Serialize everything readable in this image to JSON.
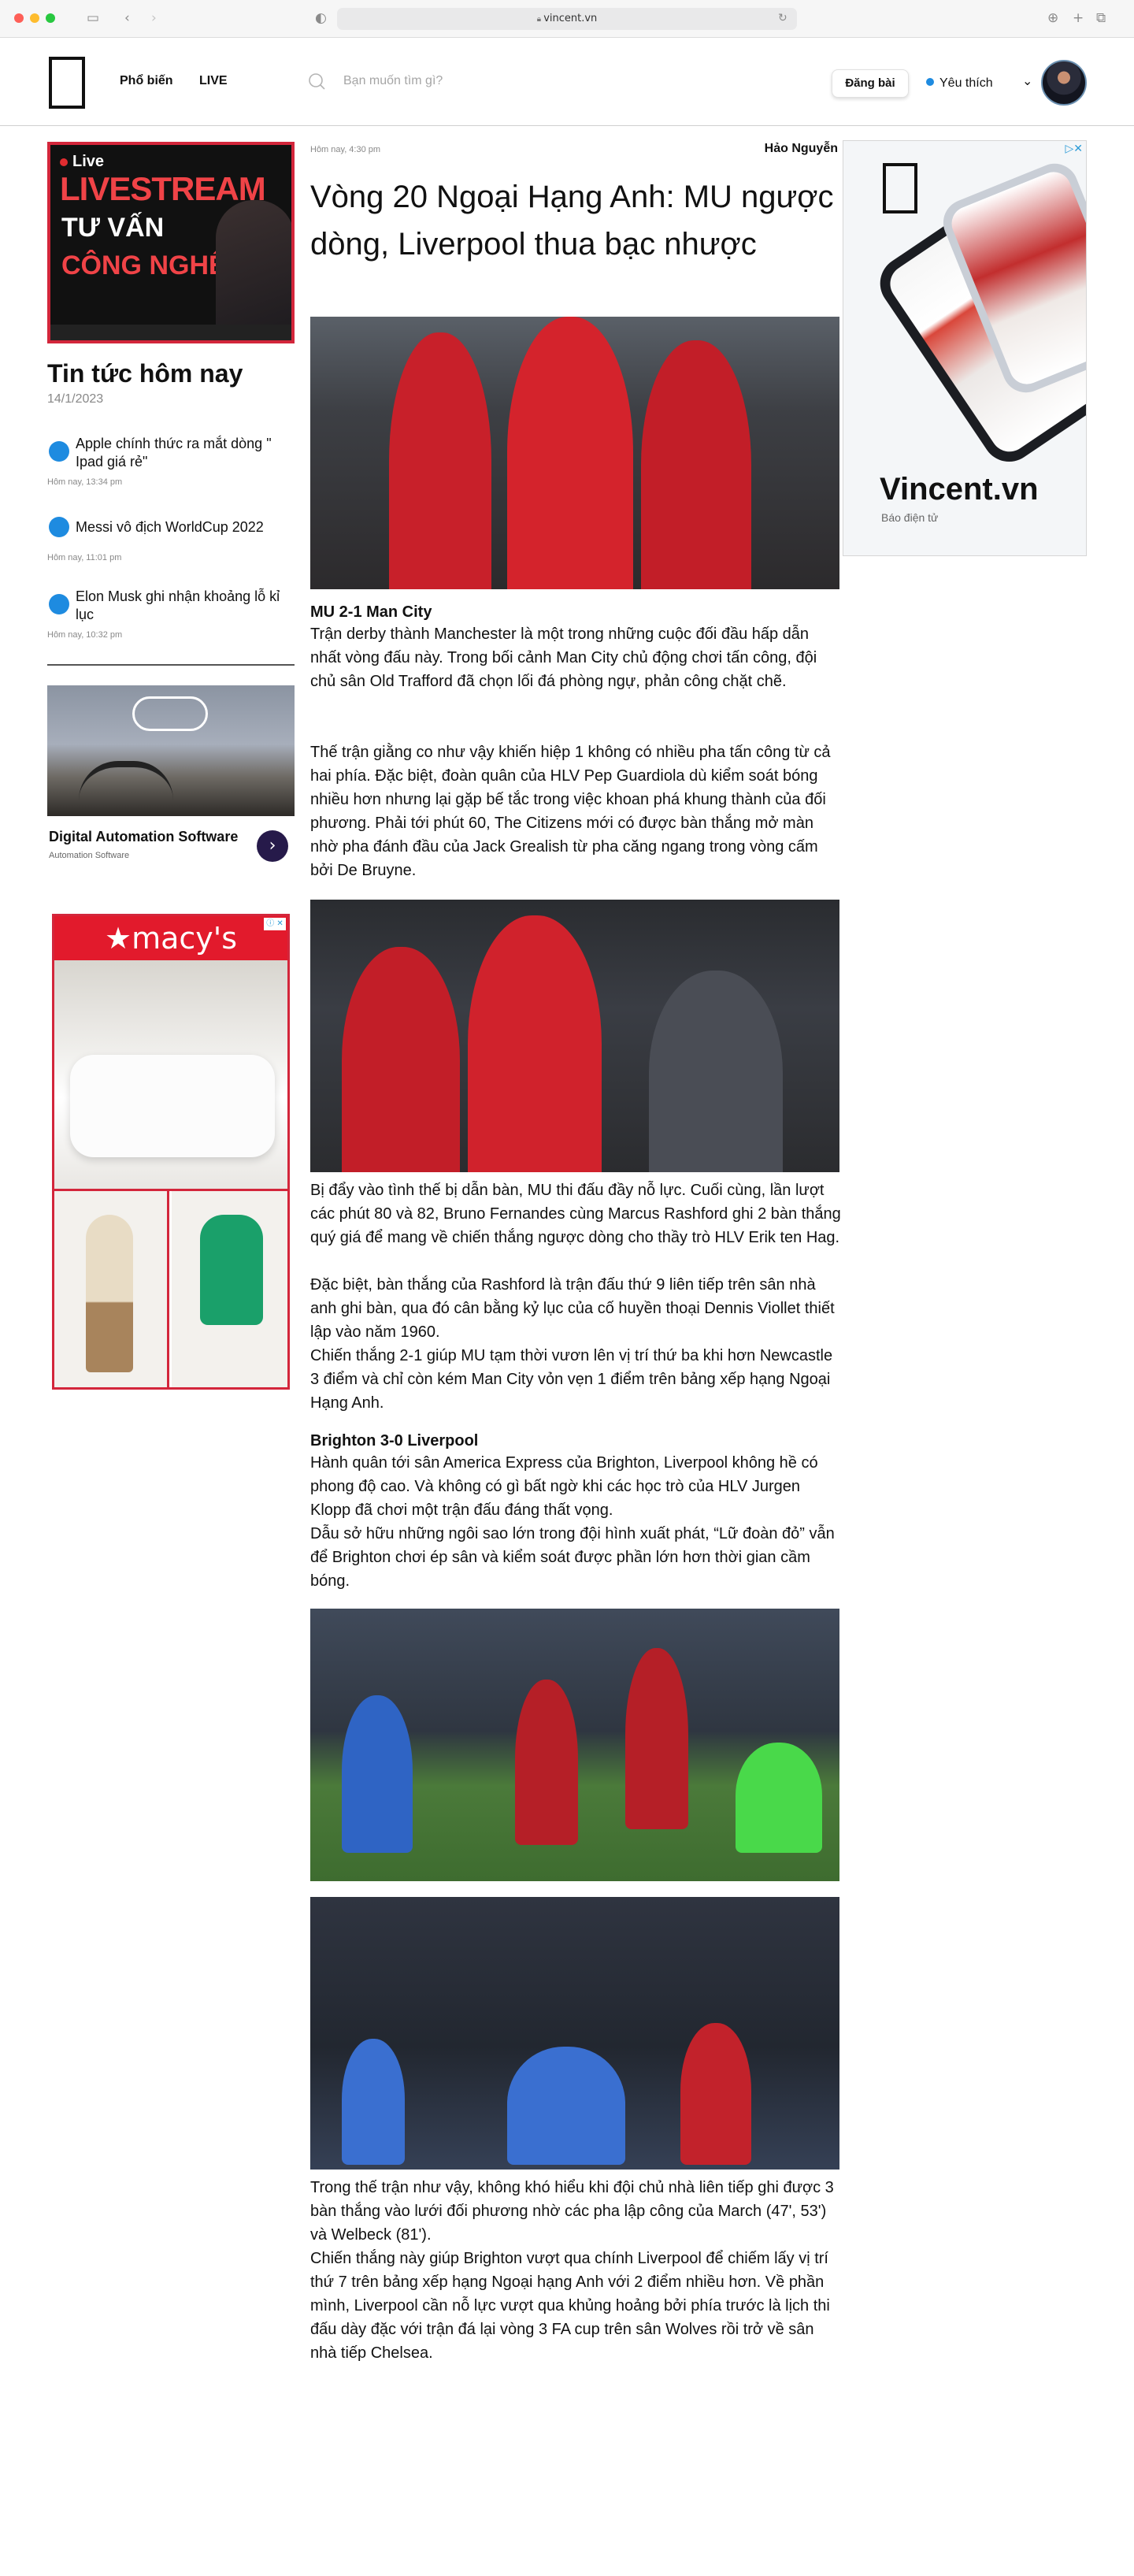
{
  "browser": {
    "url": "vincent.vn"
  },
  "header": {
    "nav": [
      "Phổ biến",
      "LIVE"
    ],
    "search_placeholder": "Bạn muốn tìm gì?",
    "post_button": "Đăng bài",
    "favorites": "Yêu thích",
    "accent": "#1e8be0"
  },
  "left": {
    "live_banner": {
      "tag": "Live",
      "line1": "LIVESTREAM",
      "line2": "TƯ VẤN",
      "line3": "CÔNG NGHỆ"
    },
    "today": {
      "title": "Tin tức hôm nay",
      "date": "14/1/2023",
      "items": [
        {
          "title": "Apple chính thức ra mắt dòng \" Ipad giá rẻ\"",
          "time": "Hôm nay, 13:34 pm"
        },
        {
          "title": "Messi vô địch WorldCup 2022",
          "time": "Hôm nay, 11:01 pm"
        },
        {
          "title": "Elon Musk ghi nhận khoảng lỗ kỉ lục",
          "time": "Hôm nay, 10:32 pm"
        }
      ]
    },
    "promo": {
      "title": "Digital Automation Software",
      "subtitle": "Automation Software"
    },
    "macys_logo": "★macy's"
  },
  "article": {
    "time": "Hôm nay, 4:30 pm",
    "author": "Hảo Nguyễn",
    "headline": "Vòng 20 Ngoại Hạng Anh:  MU ngược dòng, Liverpool thua bạc nhược",
    "section1_title": "MU 2-1 Man City",
    "p1": "Trận derby thành Manchester là một trong những cuộc đối đầu hấp dẫn nhất vòng đấu này. Trong bối cảnh Man City chủ động chơi tấn công, đội chủ sân Old Trafford đã chọn lối đá phòng ngự, phản công chặt chẽ.",
    "p2": "Thế trận giằng co như vậy khiến hiệp 1 không có nhiều pha tấn công từ cả hai phía. Đặc biệt, đoàn quân của HLV Pep Guardiola dù kiểm soát bóng nhiều hơn nhưng lại gặp bế tắc trong việc khoan phá khung thành của đối phương. Phải tới phút 60, The Citizens mới có được bàn thắng mở màn nhờ pha đánh đầu của Jack Grealish từ pha căng ngang trong vòng cấm bởi De Bruyne.",
    "p3": "Bị đẩy vào tình thế bị dẫn bàn, MU thi đấu đầy nỗ lực. Cuối cùng, lần lượt các phút 80 và 82, Bruno Fernandes cùng Marcus Rashford ghi 2 bàn thắng quý giá để mang về chiến thắng ngược dòng cho thầy trò HLV Erik ten Hag.",
    "p4": "Đặc biệt, bàn thắng của Rashford là trận đấu thứ 9 liên tiếp trên sân nhà anh ghi bàn, qua đó cân bằng kỷ lục của cố huyền thoại Dennis Viollet thiết lập vào năm 1960.",
    "p5": "Chiến thắng 2-1 giúp MU tạm thời vươn lên vị trí thứ ba khi hơn Newcastle 3 điểm và chỉ còn kém Man City vỏn vẹn 1 điểm trên bảng xếp hạng Ngoại Hạng Anh.",
    "section2_title": "Brighton 3-0 Liverpool",
    "p6": "Hành quân tới sân America Express của Brighton, Liverpool không hề có phong độ cao. Và không có gì bất ngờ khi các học trò của HLV Jurgen Klopp đã chơi một trận đấu đáng thất vọng.",
    "p7": "Dẫu sở hữu những ngôi sao lớn trong đội hình xuất phát, “Lữ đoàn đỏ” vẫn để Brighton chơi ép sân và kiểm soát được phần lớn hơn thời gian cầm bóng.",
    "p8": "Trong thế trận như vậy, không khó hiểu khi đội chủ nhà liên tiếp ghi được 3 bàn thắng vào lưới đối phương nhờ các pha lập công của March (47', 53') và Welbeck (81').",
    "p9": "Chiến thắng này giúp Brighton vượt qua chính Liverpool để chiếm lấy vị trí thứ 7 trên bảng xếp hạng Ngoại hạng Anh với 2 điểm nhiều hơn. Về phần mình, Liverpool cần nỗ lực vượt qua khủng hoảng bởi phía trước là lịch thi đấu dày đặc với trận đá lại vòng 3 FA cup trên sân Wolves rồi trở về sân nhà tiếp Chelsea."
  },
  "right_ad": {
    "brand": "Vincent.vn",
    "subtitle": "Báo điện tử"
  }
}
